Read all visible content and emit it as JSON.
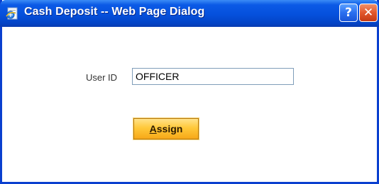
{
  "window": {
    "title": "Cash Deposit -- Web Page Dialog",
    "icon": "ie-page-icon",
    "help_glyph": "?",
    "close_glyph": "✕"
  },
  "form": {
    "user_id_label": "User ID",
    "user_id_value": "OFFICER",
    "assign_label": "Assign",
    "assign_label_accel": "A",
    "assign_label_rest": "ssign"
  },
  "colors": {
    "titlebar": "#0550dc",
    "frame": "#0a3fcf",
    "assign_button": "#ffc93a",
    "close_button": "#e2572c"
  }
}
